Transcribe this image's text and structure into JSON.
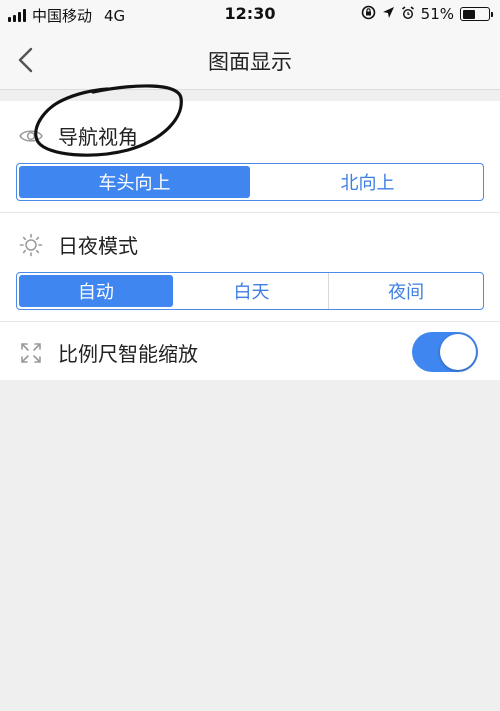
{
  "status_bar": {
    "carrier": "中国移动",
    "network": "4G",
    "time": "12:30",
    "battery_percent": "51%",
    "battery_level": 0.51
  },
  "nav": {
    "title": "图面显示"
  },
  "sections": {
    "navigation_view": {
      "title": "导航视角",
      "options": [
        "车头向上",
        "北向上"
      ],
      "selected_index": 0
    },
    "day_night_mode": {
      "title": "日夜模式",
      "options": [
        "自动",
        "白天",
        "夜间"
      ],
      "selected_index": 0
    },
    "scale_zoom": {
      "title": "比例尺智能缩放",
      "enabled": true
    }
  },
  "colors": {
    "accent": "#3f86f0",
    "background": "#efefef",
    "panel": "#ffffff"
  }
}
